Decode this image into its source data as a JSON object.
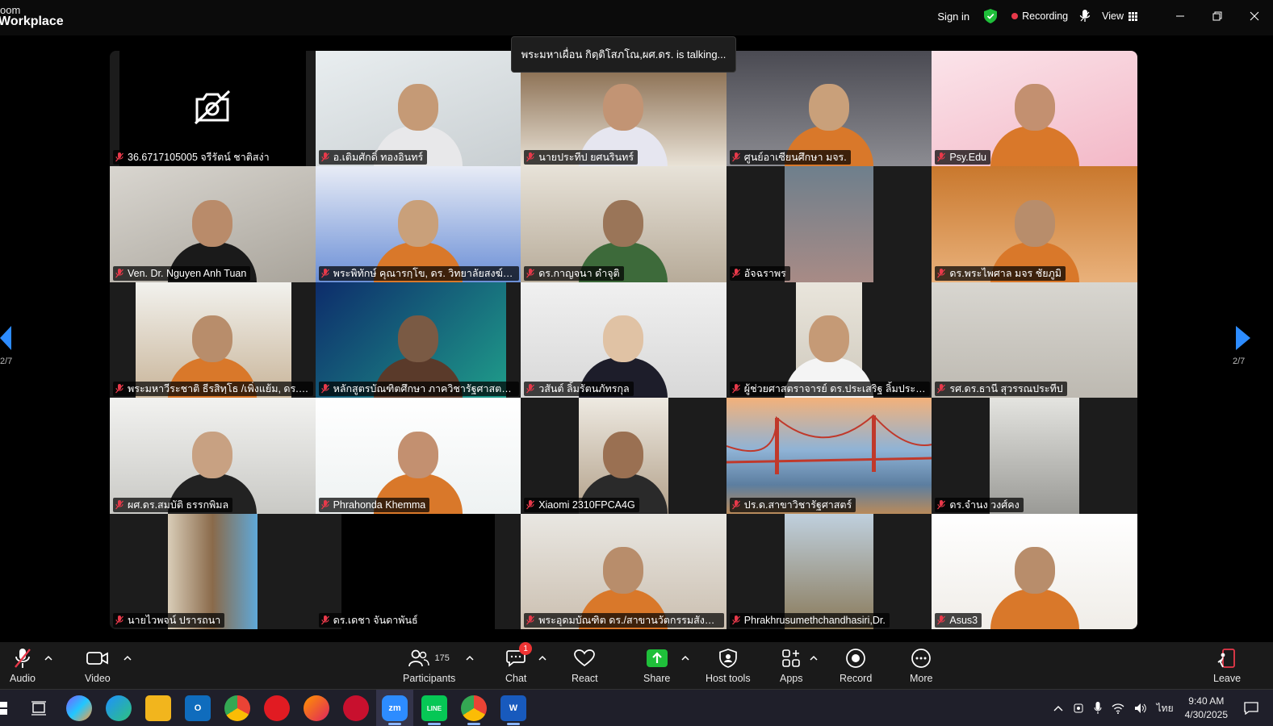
{
  "app": {
    "logo_line1": "oom",
    "logo_line2": "Workplace"
  },
  "titlebar": {
    "sign_in": "Sign in",
    "recording": "Recording",
    "view": "View"
  },
  "talking_banner": "พระมหาเผื่อน กิตฺติโสภโณ,ผศ.ดร. is talking...",
  "pagination": {
    "left": "2/7",
    "right": "2/7"
  },
  "participants": [
    "36.6717105005 จรีรัตน์ ชาติสง่า",
    "อ.เติมศักดิ์ ทองอินทร์",
    "นายประทีป ยศนรินทร์",
    "ศูนย์อาเซียนศึกษา มจร.",
    "Psy.Edu",
    "Ven. Dr. Nguyen Anh Tuan",
    "พระพิทักษ์ คุณารกฺโข, ดร. วิทยาลัยสงฆ์ลำพ...",
    "ดร.กาญจนา ดำจุติ",
    "อัจฉราพร",
    "ดร.พระไพศาล มจร ชัยภูมิ",
    "พระมหาวีระชาติ ธีรสิทฺโธ /เพิ่งแย้ม, ดร. มจร.อ...",
    "หลักสูตรบัณฑิตศึกษา ภาควิชารัฐศาสตร์ คณะ...",
    "วสันต์ ลิ้มรัตนภัทรกุล",
    "ผู้ช่วยศาสตราจารย์ ดร.ประเสริฐ ลิ้มประเสริฐ",
    "รศ.ดร.ธานี สุวรรณประทีป",
    "ผศ.ดร.สมบัติ ธรรกพิมล",
    "Phrahonda Khemma",
    "Xiaomi 2310FPCA4G",
    "ปร.ด.สาขาวิชารัฐศาสตร์",
    "ดร.จำนง วงศ์คง",
    "นายไวพจน์ ปรารถนา",
    "ดร.เดชา จันดาพันธ์",
    "พระอุดมบัณฑิต ดร./สาขานวัตกรรมสังคมและ...",
    "Phrakhrusumethchandhasiri,Dr.",
    "Asus3"
  ],
  "toolbar": {
    "audio": "Audio",
    "video": "Video",
    "participants": "Participants",
    "participant_count": "175",
    "chat": "Chat",
    "chat_badge": "1",
    "react": "React",
    "share": "Share",
    "host_tools": "Host tools",
    "apps": "Apps",
    "record": "Record",
    "more": "More",
    "leave": "Leave"
  },
  "taskbar": {
    "zoom": "zm",
    "line": "LINE",
    "word": "W",
    "outlook": "O",
    "lang": "ไทย",
    "time": "9:40 AM",
    "date": "4/30/2025"
  },
  "colors": {
    "accent_green": "#1fbf3a",
    "mute_red": "#e8394a",
    "speaker_outline": "#9be36b",
    "monk_robe": "#d9782a"
  }
}
